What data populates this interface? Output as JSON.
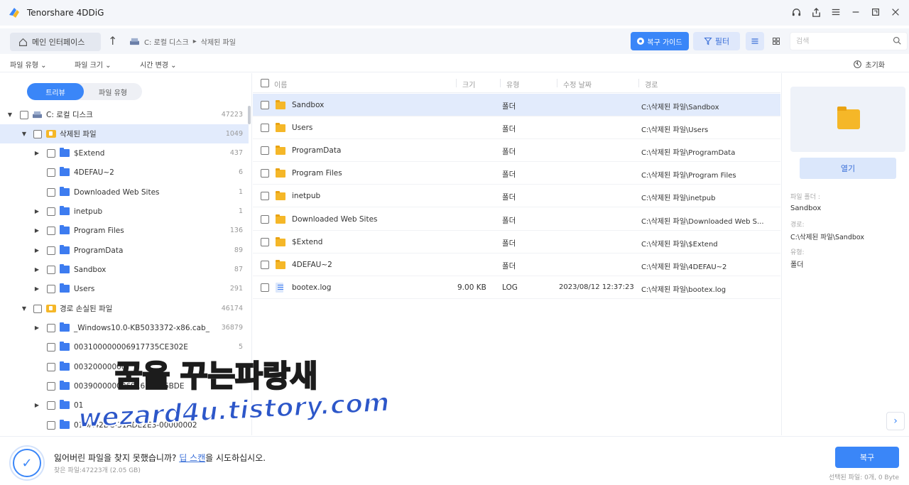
{
  "app": {
    "title": "Tenorshare 4DDiG"
  },
  "nav": {
    "home_label": "메인 인터페이스",
    "path": [
      "C: 로컬 디스크",
      "삭제된 파일"
    ],
    "guide_label": "복구 가이드",
    "filter_label": "필터",
    "search_placeholder": "검색"
  },
  "filters": {
    "file_type": "파일 유형",
    "file_size": "파일 크기",
    "time_change": "시간 변경",
    "reset": "초기화"
  },
  "tree": {
    "toggle_tree": "트리뷰",
    "toggle_type": "파일 유형",
    "items": [
      {
        "label": "C: 로컬 디스크",
        "count": "47223"
      },
      {
        "label": "삭제된 파일",
        "count": "1049"
      },
      {
        "label": "$Extend",
        "count": "437"
      },
      {
        "label": "4DEFAU~2",
        "count": "6"
      },
      {
        "label": "Downloaded Web Sites",
        "count": "1"
      },
      {
        "label": "inetpub",
        "count": "1"
      },
      {
        "label": "Program Files",
        "count": "136"
      },
      {
        "label": "ProgramData",
        "count": "89"
      },
      {
        "label": "Sandbox",
        "count": "87"
      },
      {
        "label": "Users",
        "count": "291"
      },
      {
        "label": "경로 손실된 파일",
        "count": "46174"
      },
      {
        "label": "_Windows10.0-KB5033372-x86.cab_",
        "count": "36879"
      },
      {
        "label": "003100000006917735CE302E",
        "count": "5"
      },
      {
        "label": "00320000000",
        "count": ""
      },
      {
        "label": "00390000000691637226BDE",
        "count": ""
      },
      {
        "label": "01",
        "count": ""
      },
      {
        "label": "01DA42DC-31ADE2E3-00000002",
        "count": ""
      }
    ]
  },
  "list": {
    "headers": {
      "name": "이름",
      "size": "크기",
      "type": "유형",
      "date": "수정 날짜",
      "path": "경로"
    },
    "rows": [
      {
        "name": "Sandbox",
        "size": "",
        "type": "폴더",
        "date": "",
        "path": "C:\\삭제된 파일\\Sandbox"
      },
      {
        "name": "Users",
        "size": "",
        "type": "폴더",
        "date": "",
        "path": "C:\\삭제된 파일\\Users"
      },
      {
        "name": "ProgramData",
        "size": "",
        "type": "폴더",
        "date": "",
        "path": "C:\\삭제된 파일\\ProgramData"
      },
      {
        "name": "Program Files",
        "size": "",
        "type": "폴더",
        "date": "",
        "path": "C:\\삭제된 파일\\Program Files"
      },
      {
        "name": "inetpub",
        "size": "",
        "type": "폴더",
        "date": "",
        "path": "C:\\삭제된 파일\\inetpub"
      },
      {
        "name": "Downloaded Web Sites",
        "size": "",
        "type": "폴더",
        "date": "",
        "path": "C:\\삭제된 파일\\Downloaded Web S..."
      },
      {
        "name": "$Extend",
        "size": "",
        "type": "폴더",
        "date": "",
        "path": "C:\\삭제된 파일\\$Extend"
      },
      {
        "name": "4DEFAU~2",
        "size": "",
        "type": "폴더",
        "date": "",
        "path": "C:\\삭제된 파일\\4DEFAU~2"
      },
      {
        "name": "bootex.log",
        "size": "9.00 KB",
        "type": "LOG",
        "date": "2023/08/12 12:37:23",
        "path": "C:\\삭제된 파일\\bootex.log"
      }
    ]
  },
  "preview": {
    "open_label": "열기",
    "file_folder_label": "파일 폴더 :",
    "file_folder_value": "Sandbox",
    "path_label": "경로:",
    "path_value": "C:\\삭제된 파일\\Sandbox",
    "type_label": "유형:",
    "type_value": "폴더"
  },
  "bottom": {
    "message_before": "잃어버린 파일을 찾지 못했습니까? ",
    "message_link": "딥 스캔",
    "message_after": "을 시도하십시오.",
    "found": "찾은 파일:47223개 (2.05 GB)",
    "recover_label": "복구",
    "selected": "선택된 파일: 0개, 0 Byte"
  },
  "watermark": {
    "line1": "꿈을 꾸는파랑새",
    "line2": "wezard4u.tistory.com"
  },
  "colors": {
    "accent": "#3a86f8",
    "selection": "#e2ebfc",
    "folder": "#f5b728",
    "tree_folder": "#3d7cf0"
  }
}
